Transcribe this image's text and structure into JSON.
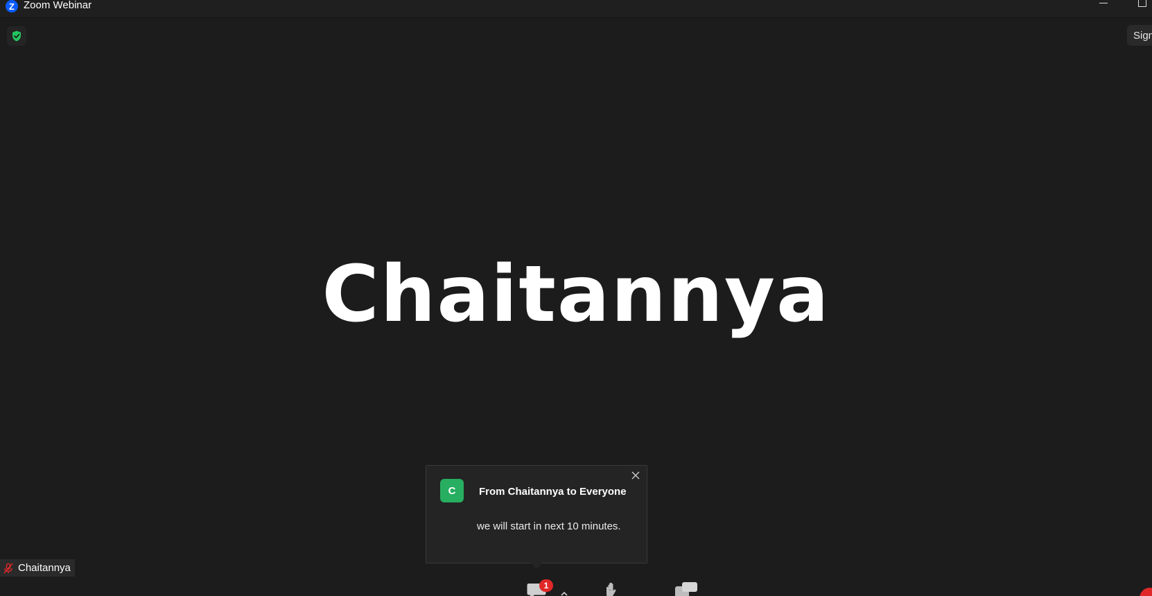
{
  "window": {
    "title": "Zoom Webinar"
  },
  "security": {
    "icon": "shield-check-icon",
    "color": "#22c55e"
  },
  "top_right": {
    "sign_label": "Sign"
  },
  "main": {
    "display_name": "Chaitannya"
  },
  "chat_popup": {
    "avatar_initial": "C",
    "avatar_color": "#27ae60",
    "from_text": "From Chaitannya to Everyone",
    "message": "we will start in next 10 minutes."
  },
  "name_tag": {
    "name": "Chaitannya",
    "mic_status_icon": "mic-muted-icon"
  },
  "toolbar": {
    "chat_badge_count": "1"
  }
}
